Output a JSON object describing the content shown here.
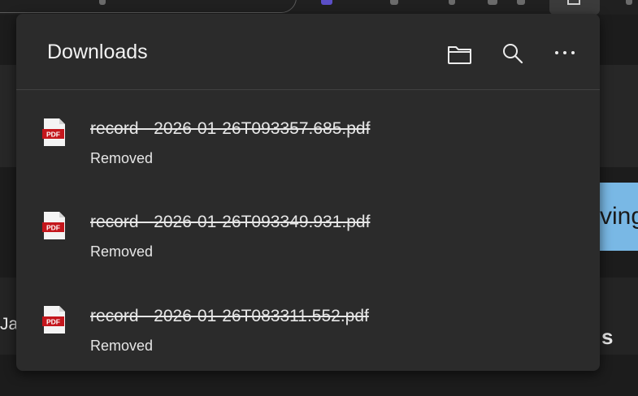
{
  "panel": {
    "title": "Downloads",
    "actions": [
      "open-folder",
      "search",
      "more-options"
    ]
  },
  "downloads": [
    {
      "name": "record - 2026-01-26T093357.685.pdf",
      "status": "Removed",
      "icon": "pdf-file-icon",
      "icon_label": "PDF"
    },
    {
      "name": "record - 2026-01-26T093349.931.pdf",
      "status": "Removed",
      "icon": "pdf-file-icon",
      "icon_label": "PDF"
    },
    {
      "name": "record - 2026-01-26T083311.552.pdf",
      "status": "Removed",
      "icon": "pdf-file-icon",
      "icon_label": "PDF"
    }
  ],
  "background": {
    "left_fragment": "Ja",
    "right_fragment": "ving",
    "bottom_right_fragment": "s"
  },
  "colors": {
    "panel_bg": "#2b2b2b",
    "pdf_red": "#c4161c",
    "background_accent": "#79b8e5"
  }
}
